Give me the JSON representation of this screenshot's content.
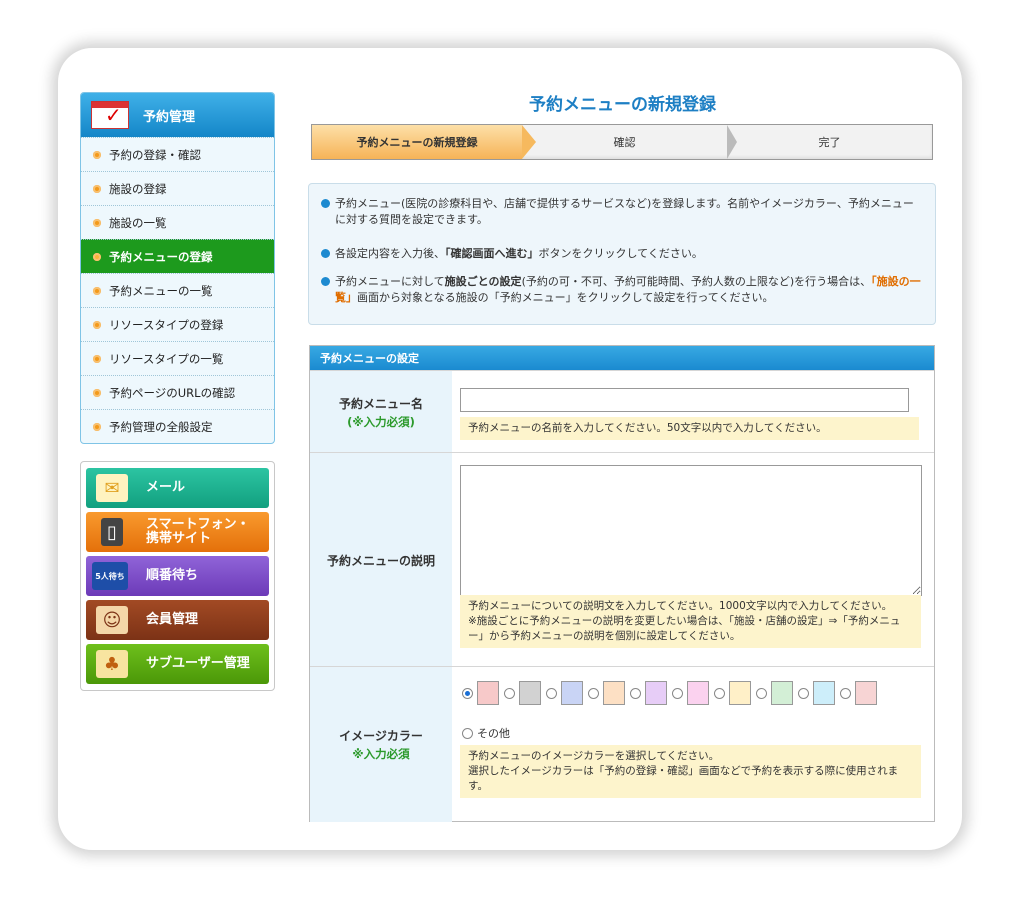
{
  "page_title": "予約メニューの新規登録",
  "steps": [
    "予約メニューの新規登録",
    "確認",
    "完了"
  ],
  "sidebar": {
    "heading": "予約管理",
    "items": [
      {
        "label": "予約の登録・確認"
      },
      {
        "label": "施設の登録"
      },
      {
        "label": "施設の一覧"
      },
      {
        "label": "予約メニューの登録",
        "active": true
      },
      {
        "label": "予約メニューの一覧"
      },
      {
        "label": "リソースタイプの登録"
      },
      {
        "label": "リソースタイプの一覧"
      },
      {
        "label": "予約ページのURLの確認"
      },
      {
        "label": "予約管理の全般設定"
      }
    ],
    "services": [
      {
        "label": "メール",
        "color": "#1aaf8e"
      },
      {
        "label1": "スマートフォン・",
        "label2": "携帯サイト",
        "color": "#f07d12"
      },
      {
        "label": "順番待ち",
        "color": "#7b4bc4",
        "icon_text": "5人待ち"
      },
      {
        "label": "会員管理",
        "color": "#8b3f1f"
      },
      {
        "label": "サブユーザー管理",
        "color": "#58a80f"
      }
    ]
  },
  "info": {
    "line1": "予約メニュー(医院の診療科目や、店舗で提供するサービスなど)を登録します。名前やイメージカラー、予約メニューに対する質問を設定できます。",
    "line2_pre": "各設定内容を入力後、",
    "line2_strong": "「確認画面へ進む」",
    "line2_post": "ボタンをクリックしてください。",
    "line3_pre": "予約メニューに対して",
    "line3_strong": "施設ごとの設定",
    "line3_mid": "(予約の可・不可、予約可能時間、予約人数の上限など)を行う場合は、",
    "line3_link": "「施設の一覧」",
    "line3_post": "画面から対象となる施設の「予約メニュー」をクリックして設定を行ってください。"
  },
  "form": {
    "header": "予約メニューの設定",
    "name": {
      "label": "予約メニュー名",
      "required": "(※入力必須)",
      "value": "",
      "hint": "予約メニューの名前を入力してください。50文字以内で入力してください。"
    },
    "description": {
      "label": "予約メニューの説明",
      "value": "",
      "hint1": "予約メニューについての説明文を入力してください。1000文字以内で入力してください。",
      "hint2": "※施設ごとに予約メニューの説明を変更したい場合は、「施設・店舗の設定」⇒「予約メニュー」から予約メニューの説明を個別に設定してください。"
    },
    "color": {
      "label": "イメージカラー",
      "required": "※入力必須",
      "swatches": [
        "#f7c9c9",
        "#d2d2d2",
        "#c9d4f5",
        "#fde0c4",
        "#e7cdf7",
        "#fbd2ef",
        "#fff0c8",
        "#d3efd6",
        "#cdeefa",
        "#f7d4d4"
      ],
      "selected_index": 0,
      "other_label": "その他",
      "hint1": "予約メニューのイメージカラーを選択してください。",
      "hint2": "選択したイメージカラーは「予約の登録・確認」画面などで予約を表示する際に使用されます。"
    }
  }
}
